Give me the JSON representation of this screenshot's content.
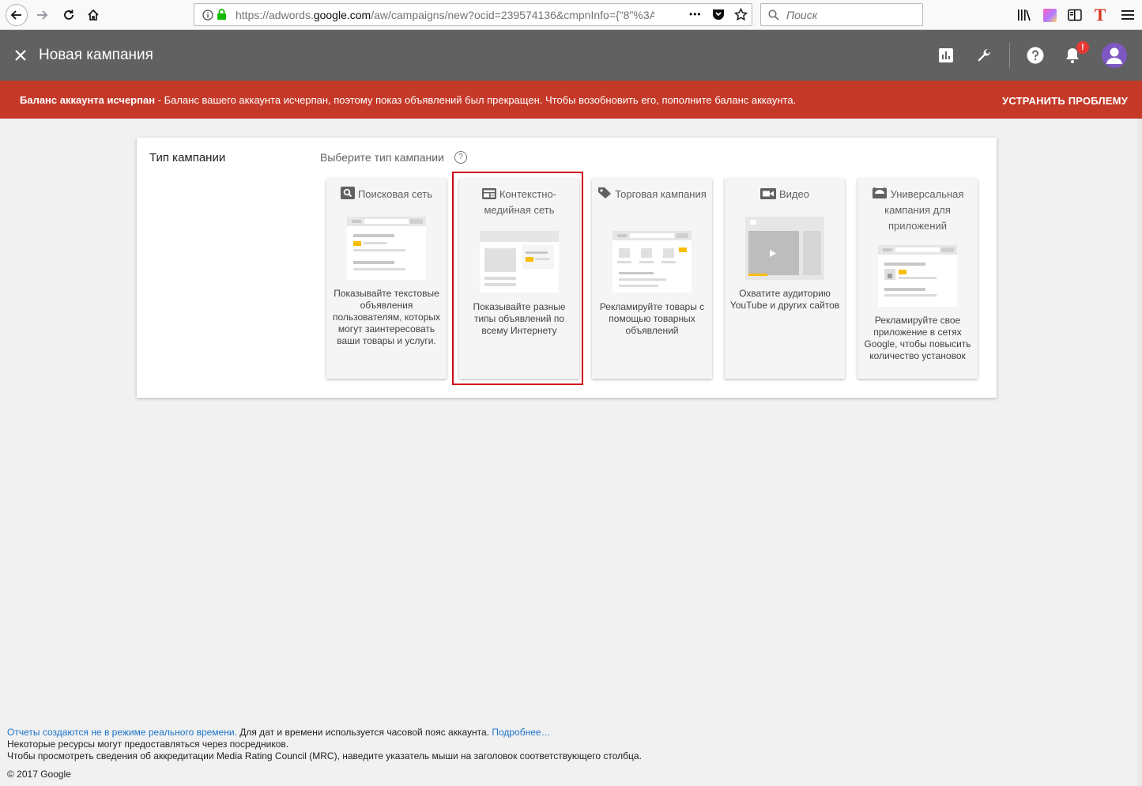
{
  "browser": {
    "url_prefix": "https://adwords.",
    "url_domain": "google.com",
    "url_suffix": "/aw/campaigns/new?ocid=239574136&cmpnInfo={\"8\"%3A",
    "search_placeholder": "Поиск",
    "more_label": "•••"
  },
  "header": {
    "title": "Новая кампания",
    "notif_count": "!"
  },
  "alert": {
    "bold": "Баланс аккаунта исчерпан",
    "message": " - Баланс вашего аккаунта исчерпан, поэтому показ объявлений был прекращен. Чтобы возобновить его, пополните баланс аккаунта.",
    "action": "УСТРАНИТЬ ПРОБЛЕМУ"
  },
  "campaign": {
    "section_label": "Тип кампании",
    "prompt": "Выберите тип кампании",
    "help": "?",
    "types": [
      {
        "title": "Поисковая сеть",
        "description": "Показывайте текстовые объявления пользователям, которых могут заинтересовать ваши товары и услуги.",
        "icon": "search-icon"
      },
      {
        "title": "Контекстно-медийная сеть",
        "description": "Показывайте разные типы объявлений по всему Интернету",
        "icon": "display-icon",
        "selected": true
      },
      {
        "title": "Торговая кампания",
        "description": "Рекламируйте товары с помощью товарных объявлений",
        "icon": "tag-icon"
      },
      {
        "title": "Видео",
        "description": "Охватите аудиторию YouTube и других сайтов",
        "icon": "video-icon"
      },
      {
        "title": "Универсальная кампания для приложений",
        "description": "Рекламируйте свое приложение в сетях Google, чтобы повысить количество установок",
        "icon": "android-icon"
      }
    ]
  },
  "footer": {
    "link1": "Отчеты создаются не в режиме реального времени.",
    "text1": " Для дат и времени используется часовой пояс аккаунта. ",
    "link2": "Подробнее…",
    "line2": "Некоторые ресурсы могут предоставляться через посредников.",
    "line3": "Чтобы просмотреть сведения об аккредитации Media Rating Council (MRC), наведите указатель мыши на заголовок соответствующего столбца.",
    "copyright": "© 2017 Google"
  },
  "colors": {
    "appbar": "#616161",
    "alert": "#c53929",
    "accent_yellow": "#fbbc04",
    "selection_border": "#d0021b"
  }
}
